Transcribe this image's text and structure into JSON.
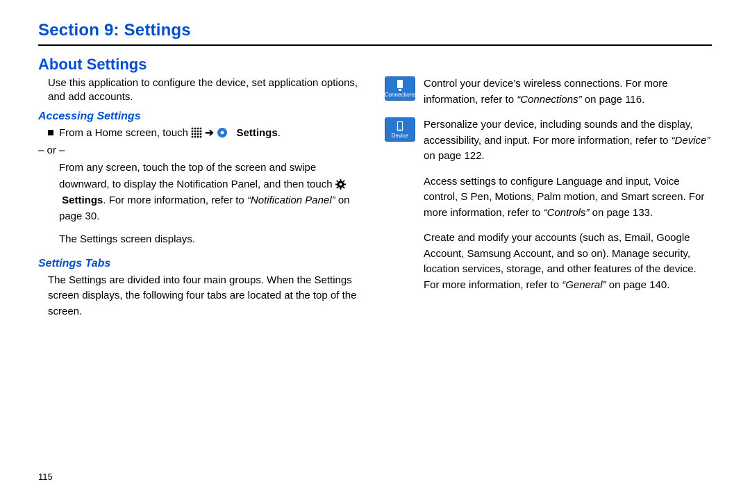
{
  "section_title": "Section 9: Settings",
  "about_title": "About Settings",
  "intro": "Use this application to configure the device, set application options, and add accounts.",
  "h_accessing": "Accessing Settings",
  "bul1_pre": "From a Home screen, touch ",
  "bul1_arrow": " ➔ ",
  "bul1_settings": "Settings",
  "bul1_period": ".",
  "or_text": "– or –",
  "bul2a": "From any screen, touch the top of the screen and swipe downward, to display the Notification Panel, and then touch ",
  "bul2_settings": "Settings",
  "bul2b": ". For more information, refer to ",
  "bul2_ref": "“Notification Panel”",
  "bul2c": " on page 30.",
  "displays": "The Settings screen displays.",
  "h_tabs": "Settings Tabs",
  "tabs_intro": "The Settings are divided into four main groups. When the Settings screen displays, the following four tabs are located at the top of the screen.",
  "conn_label": "Connections",
  "conn_text_a": "Control your device’s wireless connections. For more information, refer to ",
  "conn_ref": "“Connections”",
  "conn_text_b": " on page 116.",
  "dev_label": "Device",
  "dev_text_a": "Personalize your device, including sounds and the display, accessibility, and input. For more information, refer to ",
  "dev_ref": "“Device”",
  "dev_text_b": " on page 122.",
  "ctrl_text_a": "Access settings to configure Language and input, Voice control, S Pen, Motions, Palm motion, and Smart screen. For more information, refer to ",
  "ctrl_ref": "“Controls”",
  "ctrl_text_b": " on page 133.",
  "gen_text_a": "Create and modify your accounts (such as, Email, Google Account, Samsung Account, and so on). Manage security, location services, storage, and other features of the device. For more information, refer to ",
  "gen_ref": "“General”",
  "gen_text_b": " on page 140.",
  "page_number": "115"
}
